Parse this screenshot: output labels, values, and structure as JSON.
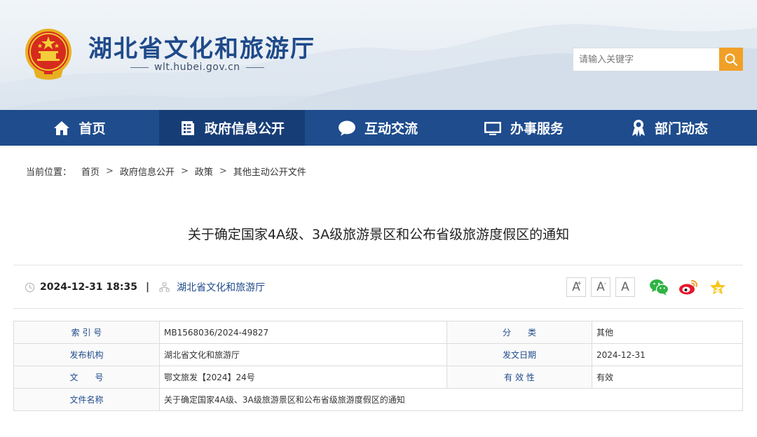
{
  "site": {
    "title": "湖北省文化和旅游厅",
    "domain": "wlt.hubei.gov.cn",
    "search_placeholder": "请输入关键字"
  },
  "nav": {
    "items": [
      {
        "label": "首页",
        "icon": "home-icon"
      },
      {
        "label": "政府信息公开",
        "icon": "document-icon"
      },
      {
        "label": "互动交流",
        "icon": "chat-bubble-icon"
      },
      {
        "label": "办事服务",
        "icon": "monitor-icon"
      },
      {
        "label": "部门动态",
        "icon": "award-icon"
      }
    ],
    "active_index": 1
  },
  "breadcrumb": {
    "lead": "当前位置：",
    "items": [
      "首页",
      "政府信息公开",
      "政策",
      "其他主动公开文件"
    ],
    "separator": ">"
  },
  "article": {
    "title": "关于确定国家4A级、3A级旅游景区和公布省级旅游度假区的通知",
    "datetime": "2024-12-31 18:35",
    "separator": "|",
    "source": "湖北省文化和旅游厅"
  },
  "font_size_buttons": [
    "A",
    "A",
    "A"
  ],
  "share_icons": [
    "wechat-icon",
    "weibo-icon",
    "favorite-star-icon"
  ],
  "info_table": {
    "rows": [
      {
        "k1": "索 引 号",
        "v1": "MB1568036/2024-49827",
        "k2": "分　　类",
        "v2": "其他"
      },
      {
        "k1": "发布机构",
        "v1": "湖北省文化和旅游厅",
        "k2": "发文日期",
        "v2": "2024-12-31"
      },
      {
        "k1": "文　　号",
        "v1": "鄂文旅发【2024】24号",
        "k2": "有 效 性",
        "v2": "有效"
      }
    ],
    "last_row": {
      "k": "文件名称",
      "v": "关于确定国家4A级、3A级旅游景区和公布省级旅游度假区的通知"
    }
  },
  "colors": {
    "brand_blue": "#1e4c8d",
    "nav_active": "#173d76",
    "search_button": "#f0a027"
  }
}
